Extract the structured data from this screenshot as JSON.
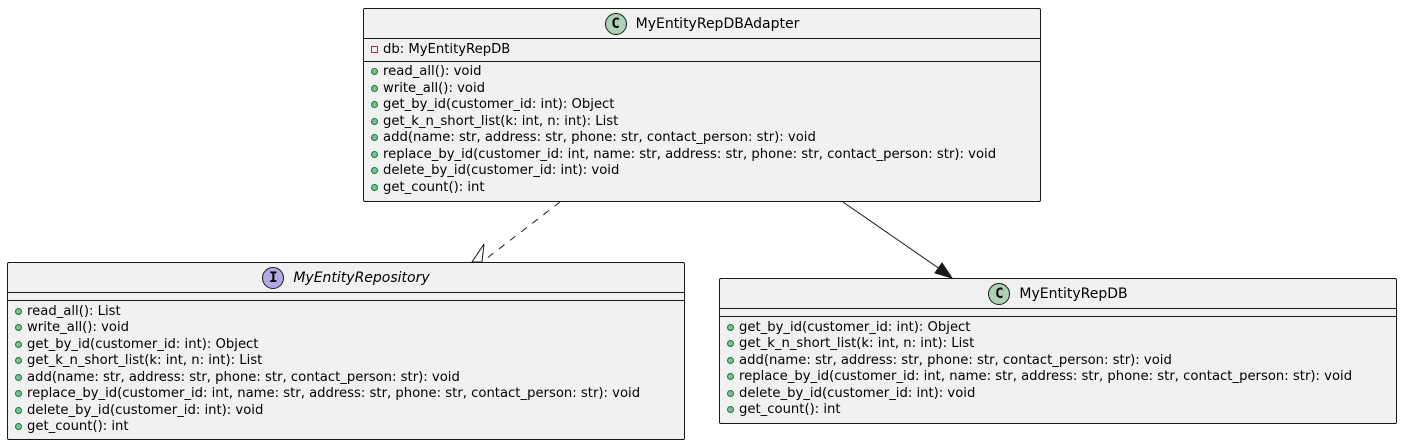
{
  "diagram": {
    "classes": [
      {
        "name": "MyEntityRepDBAdapter",
        "badge": "C",
        "kind": "class",
        "attributes": [
          {
            "visibility": "private",
            "text": "db: MyEntityRepDB"
          }
        ],
        "methods": [
          {
            "visibility": "public",
            "text": "read_all(): void"
          },
          {
            "visibility": "public",
            "text": "write_all(): void"
          },
          {
            "visibility": "public",
            "text": "get_by_id(customer_id: int): Object"
          },
          {
            "visibility": "public",
            "text": "get_k_n_short_list(k: int, n: int): List"
          },
          {
            "visibility": "public",
            "text": "add(name: str, address: str, phone: str, contact_person: str): void"
          },
          {
            "visibility": "public",
            "text": "replace_by_id(customer_id: int, name: str, address: str, phone: str, contact_person: str): void"
          },
          {
            "visibility": "public",
            "text": "delete_by_id(customer_id: int): void"
          },
          {
            "visibility": "public",
            "text": "get_count(): int"
          }
        ]
      },
      {
        "name": "MyEntityRepository",
        "badge": "I",
        "kind": "interface",
        "attributes": [],
        "methods": [
          {
            "visibility": "public",
            "text": "read_all(): List"
          },
          {
            "visibility": "public",
            "text": "write_all(): void"
          },
          {
            "visibility": "public",
            "text": "get_by_id(customer_id: int): Object"
          },
          {
            "visibility": "public",
            "text": "get_k_n_short_list(k: int, n: int): List"
          },
          {
            "visibility": "public",
            "text": "add(name: str, address: str, phone: str, contact_person: str): void"
          },
          {
            "visibility": "public",
            "text": "replace_by_id(customer_id: int, name: str, address: str, phone: str, contact_person: str): void"
          },
          {
            "visibility": "public",
            "text": "delete_by_id(customer_id: int): void"
          },
          {
            "visibility": "public",
            "text": "get_count(): int"
          }
        ]
      },
      {
        "name": "MyEntityRepDB",
        "badge": "C",
        "kind": "class",
        "attributes": [],
        "methods": [
          {
            "visibility": "public",
            "text": "get_by_id(customer_id: int): Object"
          },
          {
            "visibility": "public",
            "text": "get_k_n_short_list(k: int, n: int): List"
          },
          {
            "visibility": "public",
            "text": "add(name: str, address: str, phone: str, contact_person: str): void"
          },
          {
            "visibility": "public",
            "text": "replace_by_id(customer_id: int, name: str, address: str, phone: str, contact_person: str): void"
          },
          {
            "visibility": "public",
            "text": "delete_by_id(customer_id: int): void"
          },
          {
            "visibility": "public",
            "text": "get_count(): int"
          }
        ]
      }
    ],
    "relations": [
      {
        "from": "MyEntityRepDBAdapter",
        "to": "MyEntityRepository",
        "type": "realization"
      },
      {
        "from": "MyEntityRepDBAdapter",
        "to": "MyEntityRepDB",
        "type": "association"
      }
    ],
    "colors": {
      "class_fill": "#f1f1f1",
      "border": "#181818",
      "class_badge": "#add1b2",
      "interface_badge": "#b4a7e5",
      "public_marker": "#84be84",
      "private_marker": "#c82930"
    }
  }
}
